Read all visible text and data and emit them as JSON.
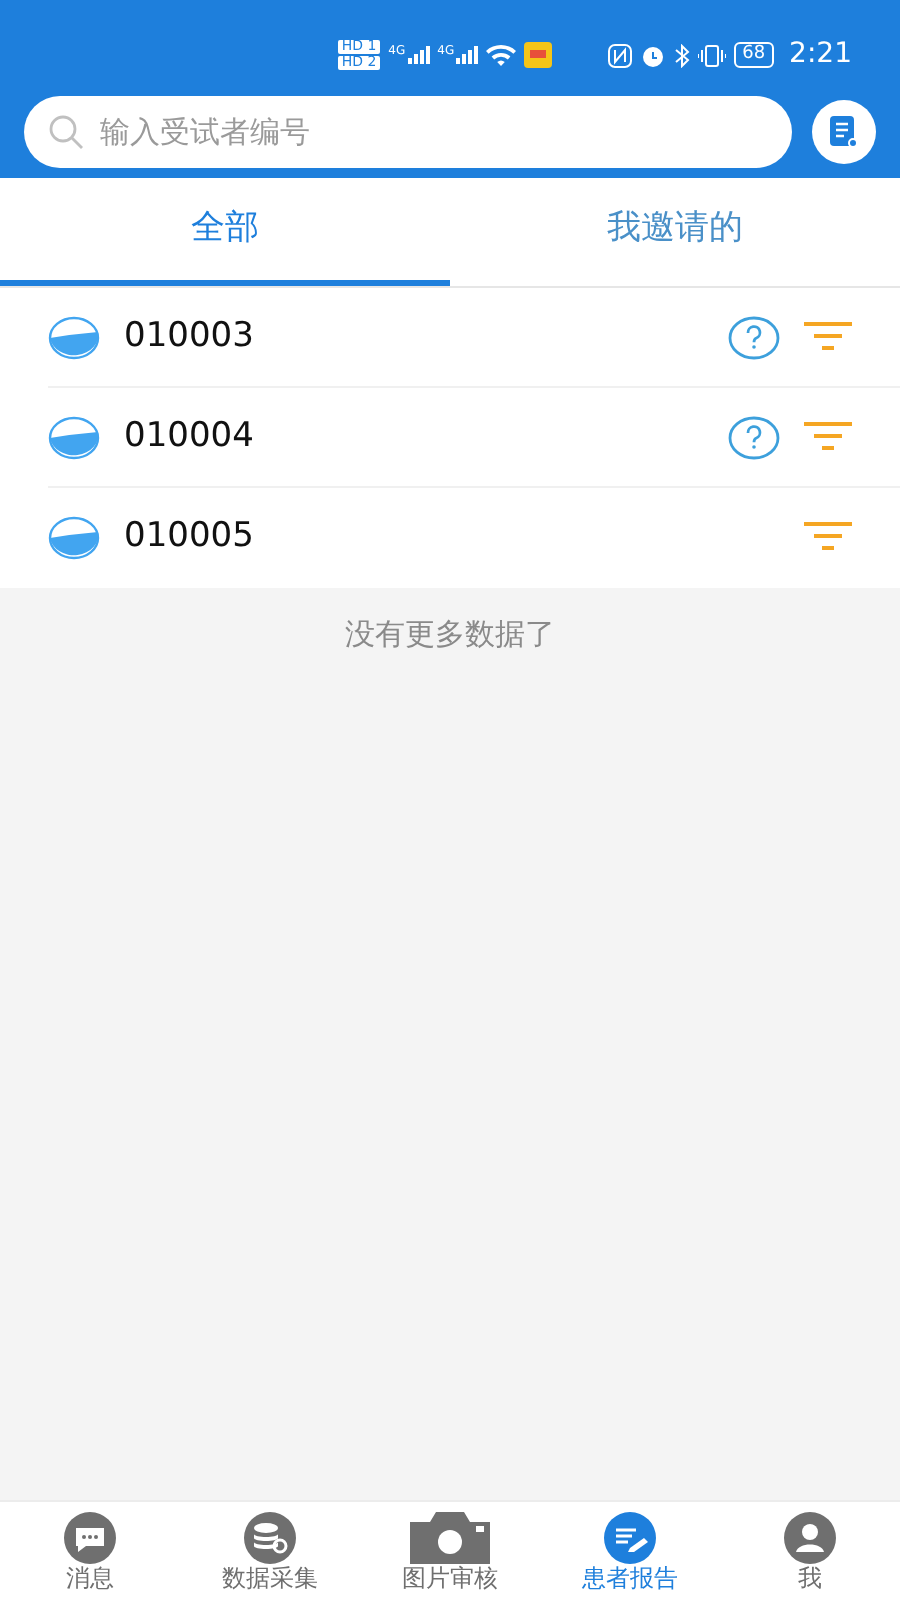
{
  "status_bar": {
    "sims": [
      "HD 1",
      "HD 2"
    ],
    "networks": [
      "4G",
      "4G"
    ],
    "battery": "68",
    "time": "2:21"
  },
  "search": {
    "placeholder": "输入受试者编号"
  },
  "tabs": [
    {
      "label": "全部",
      "selected": true
    },
    {
      "label": "我邀请的",
      "selected": false
    }
  ],
  "rows": [
    {
      "id": "010003",
      "has_question": true
    },
    {
      "id": "010004",
      "has_question": true
    },
    {
      "id": "010005",
      "has_question": false
    }
  ],
  "footer_note": "没有更多数据了",
  "nav": [
    {
      "label": "消息",
      "kind": "chat",
      "selected": false
    },
    {
      "label": "数据采集",
      "kind": "database",
      "selected": false
    },
    {
      "label": "图片审核",
      "kind": "camera",
      "selected": false
    },
    {
      "label": "患者报告",
      "kind": "report",
      "selected": true
    },
    {
      "label": "我",
      "kind": "person",
      "selected": false
    }
  ]
}
